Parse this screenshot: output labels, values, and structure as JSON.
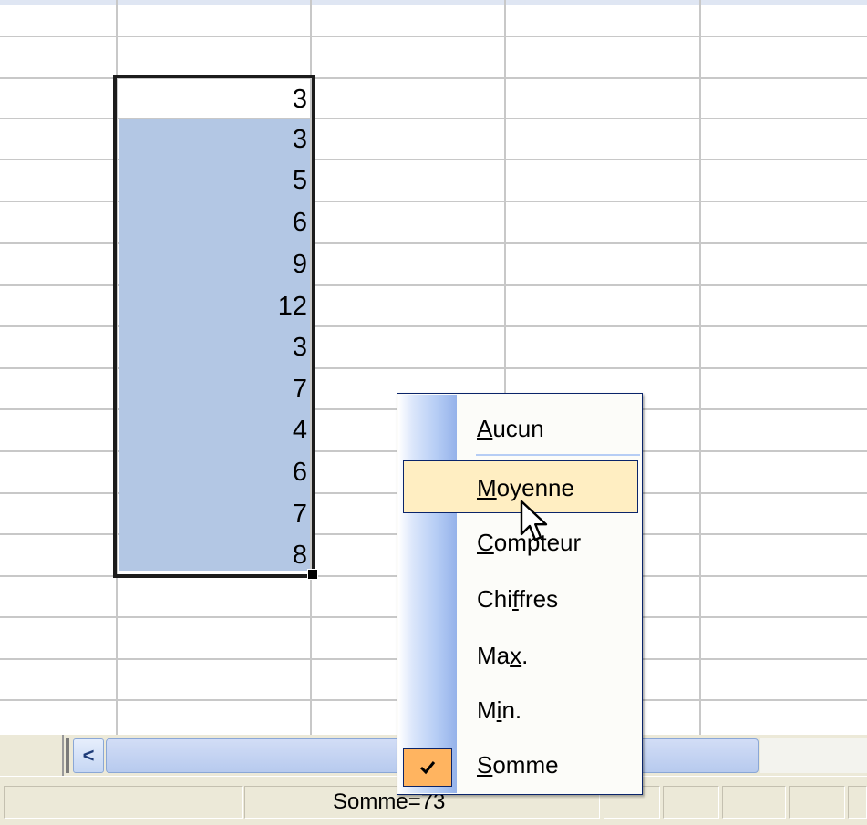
{
  "cells": [
    {
      "value": "3"
    },
    {
      "value": "3"
    },
    {
      "value": "5"
    },
    {
      "value": "6"
    },
    {
      "value": "9"
    },
    {
      "value": "12"
    },
    {
      "value": "3"
    },
    {
      "value": "7"
    },
    {
      "value": "4"
    },
    {
      "value": "6"
    },
    {
      "value": "7"
    },
    {
      "value": "8"
    }
  ],
  "context_menu": {
    "items": [
      {
        "pre": "",
        "accel": "A",
        "post": "ucun",
        "checked": false,
        "highlighted": false
      },
      {
        "pre": "",
        "accel": "M",
        "post": "oyenne",
        "checked": false,
        "highlighted": true
      },
      {
        "pre": "",
        "accel": "C",
        "post": "ompteur",
        "checked": false,
        "highlighted": false
      },
      {
        "pre": "Chi",
        "accel": "f",
        "post": "fres",
        "checked": false,
        "highlighted": false
      },
      {
        "pre": "Ma",
        "accel": "x",
        "post": ".",
        "checked": false,
        "highlighted": false
      },
      {
        "pre": "M",
        "accel": "i",
        "post": "n.",
        "checked": false,
        "highlighted": false
      },
      {
        "pre": "",
        "accel": "S",
        "post": "omme",
        "checked": true,
        "highlighted": false
      }
    ]
  },
  "status_bar": {
    "text": "Somme=73"
  },
  "scrollbar": {
    "left_arrow": "<"
  },
  "icons": {
    "check": "check-icon",
    "pointer": "arrow-pointer-icon"
  },
  "colors": {
    "selection_fill": "#b3c7e4",
    "menu_highlight": "#ffeec2",
    "menu_check_bg": "#ffb460",
    "menu_border": "#0a246a"
  }
}
